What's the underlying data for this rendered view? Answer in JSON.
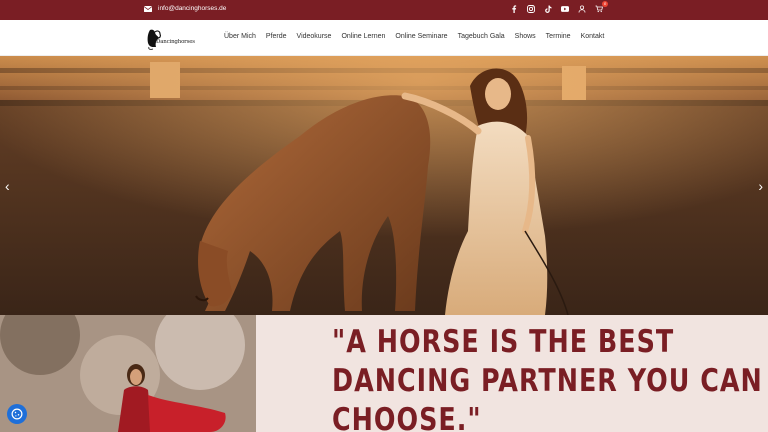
{
  "topbar": {
    "email": "info@dancinghorses.de",
    "social_icons": [
      "facebook-icon",
      "instagram-icon",
      "tiktok-icon",
      "youtube-icon",
      "user-icon",
      "cart-icon"
    ],
    "cart_count": "0"
  },
  "header": {
    "logo_text": "Dancinghorses",
    "nav": [
      "Über Mich",
      "Pferde",
      "Videokurse",
      "Online Lernen",
      "Online Seminare",
      "Tagebuch Gala",
      "Shows",
      "Termine",
      "Kontakt"
    ]
  },
  "hero": {
    "prev_label": "‹",
    "next_label": "›"
  },
  "quote": {
    "line1": "\"A HORSE IS THE BEST",
    "line2": "DANCING PARTNER YOU CAN",
    "line3": "CHOOSE.\""
  },
  "colors": {
    "brand": "#7a1e24",
    "quote_bg": "#f1e4e0",
    "fab": "#1e6fd9"
  }
}
